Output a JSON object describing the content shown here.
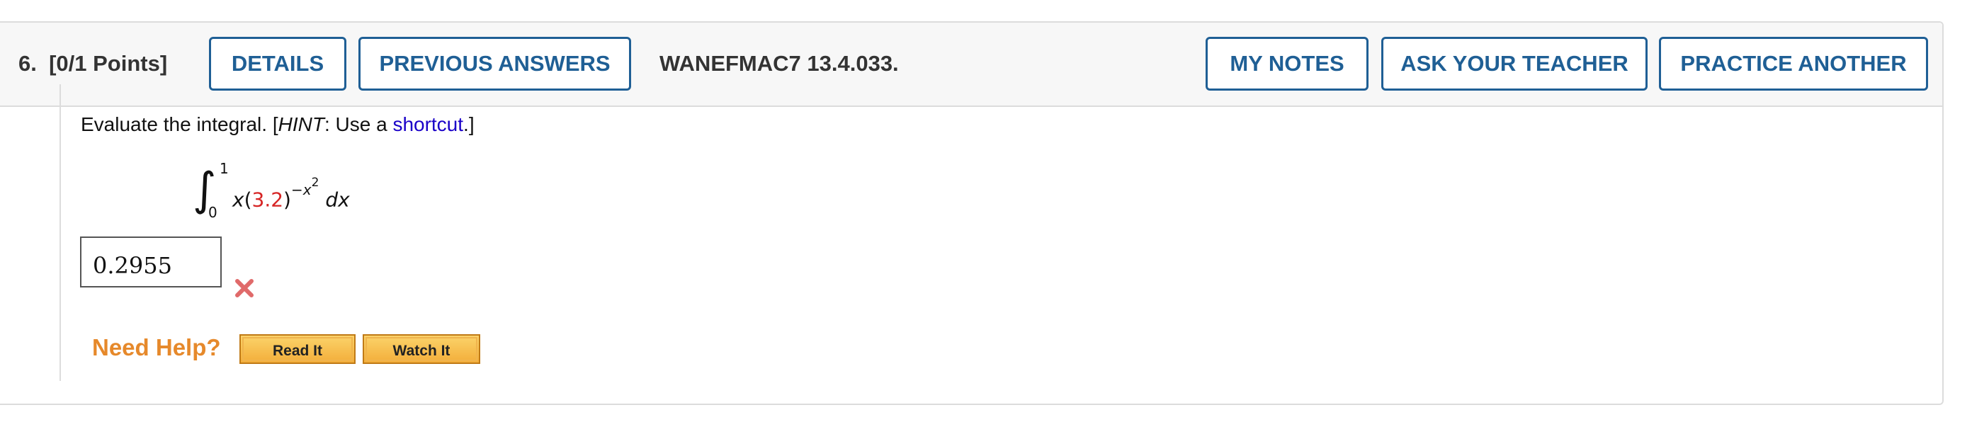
{
  "header": {
    "question_number": "6.",
    "points": "[0/1 Points]",
    "details_label": "DETAILS",
    "previous_answers_label": "PREVIOUS ANSWERS",
    "problem_code": "WANEFMAC7 13.4.033.",
    "my_notes_label": "MY NOTES",
    "ask_teacher_label": "ASK YOUR TEACHER",
    "practice_another_label": "PRACTICE ANOTHER"
  },
  "question": {
    "prompt_start": "Evaluate the integral. [",
    "hint_word": "HINT",
    "prompt_middle": ": Use a ",
    "link_text": "shortcut",
    "prompt_end": ".]",
    "integral": {
      "upper_limit": "1",
      "lower_limit": "0",
      "integrand_var": "x",
      "open_paren": "(",
      "base": "3.2",
      "close_paren": ")",
      "exponent_sign": "−",
      "exponent_var": "x",
      "exponent_power": "2",
      "differential": "dx"
    }
  },
  "answer": {
    "value": "0.2955",
    "status": "incorrect",
    "status_icon": "x-mark-icon",
    "status_color": "#e06a6a"
  },
  "help": {
    "label": "Need Help?",
    "read_it_label": "Read It",
    "watch_it_label": "Watch It",
    "label_color": "#e6892b"
  },
  "colors": {
    "primary": "#1f5f95",
    "link": "#1a00c8",
    "highlight_number": "#d62424"
  }
}
